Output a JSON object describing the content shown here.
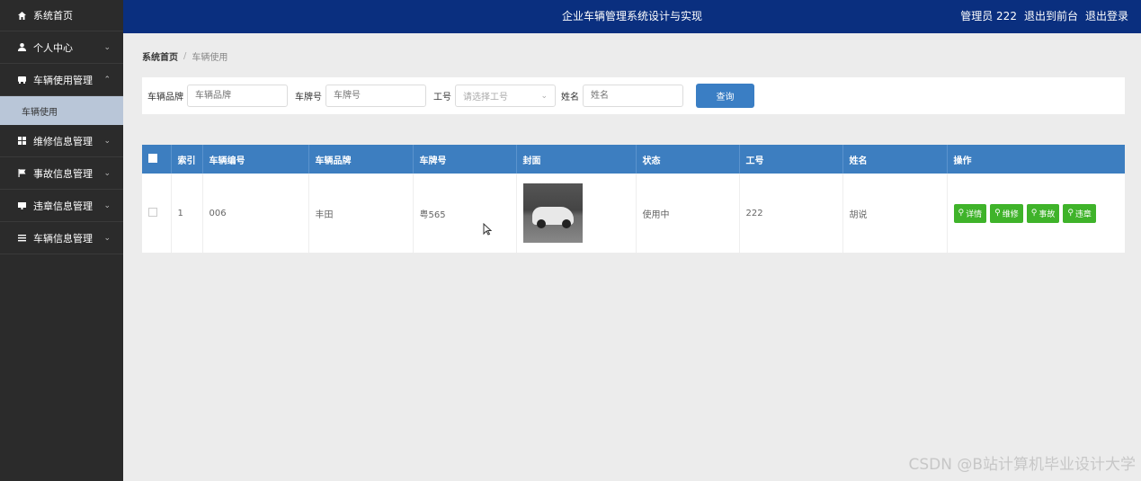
{
  "sidebar": {
    "items": [
      {
        "label": "系统首页",
        "icon": "home-icon"
      },
      {
        "label": "个人中心",
        "icon": "user-icon"
      },
      {
        "label": "车辆使用管理",
        "icon": "car-icon"
      },
      {
        "label": "维修信息管理",
        "icon": "grid-icon"
      },
      {
        "label": "事故信息管理",
        "icon": "flag-icon"
      },
      {
        "label": "违章信息管理",
        "icon": "card-icon"
      },
      {
        "label": "车辆信息管理",
        "icon": "list-icon"
      }
    ],
    "sub_item": "车辆使用"
  },
  "header": {
    "title": "企业车辆管理系统设计与实现",
    "user_text": "管理员 222",
    "switch_account": "退出到前台",
    "logout": "退出登录"
  },
  "breadcrumb": {
    "home": "系统首页",
    "current": "车辆使用"
  },
  "search": {
    "brand_label": "车辆品牌",
    "brand_placeholder": "车辆品牌",
    "plate_label": "车牌号",
    "plate_placeholder": "车牌号",
    "job_label": "工号",
    "job_placeholder": "请选择工号",
    "name_label": "姓名",
    "name_placeholder": "姓名",
    "button": "查询"
  },
  "table": {
    "headers": [
      "索引",
      "车辆编号",
      "车辆品牌",
      "车牌号",
      "封面",
      "状态",
      "工号",
      "姓名",
      "操作"
    ],
    "rows": [
      {
        "index": "1",
        "vehicle_no": "006",
        "brand": "丰田",
        "plate": "粤565",
        "status": "使用中",
        "job_no": "222",
        "name": "胡说"
      }
    ],
    "actions": [
      "详情",
      "维修",
      "事故",
      "违章"
    ]
  },
  "watermark": "CSDN @B站计算机毕业设计大学"
}
